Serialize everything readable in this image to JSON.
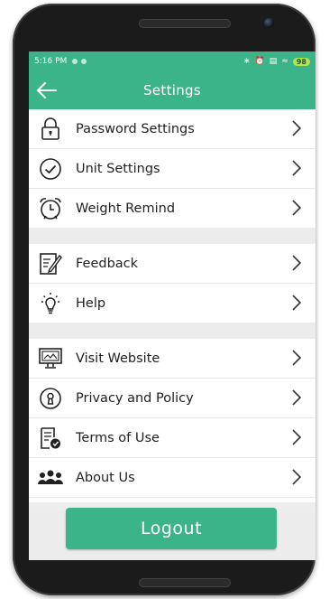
{
  "status_bar": {
    "time": "5:16 PM",
    "battery": "98"
  },
  "header": {
    "title": "Settings"
  },
  "groups": [
    {
      "items": [
        {
          "label": "Password Settings",
          "icon": "lock-icon"
        },
        {
          "label": "Unit Settings",
          "icon": "check-circle-icon"
        },
        {
          "label": "Weight Remind",
          "icon": "alarm-clock-icon"
        }
      ]
    },
    {
      "items": [
        {
          "label": "Feedback",
          "icon": "edit-note-icon"
        },
        {
          "label": "Help",
          "icon": "lightbulb-icon"
        }
      ]
    },
    {
      "items": [
        {
          "label": "Visit Website",
          "icon": "monitor-icon"
        },
        {
          "label": "Privacy and Policy",
          "icon": "keyhole-icon"
        },
        {
          "label": "Terms of Use",
          "icon": "document-check-icon"
        },
        {
          "label": "About Us",
          "icon": "users-icon"
        }
      ]
    }
  ],
  "footer": {
    "logout_label": "Logout"
  },
  "colors": {
    "accent": "#3cb48a",
    "background": "#ececec"
  }
}
